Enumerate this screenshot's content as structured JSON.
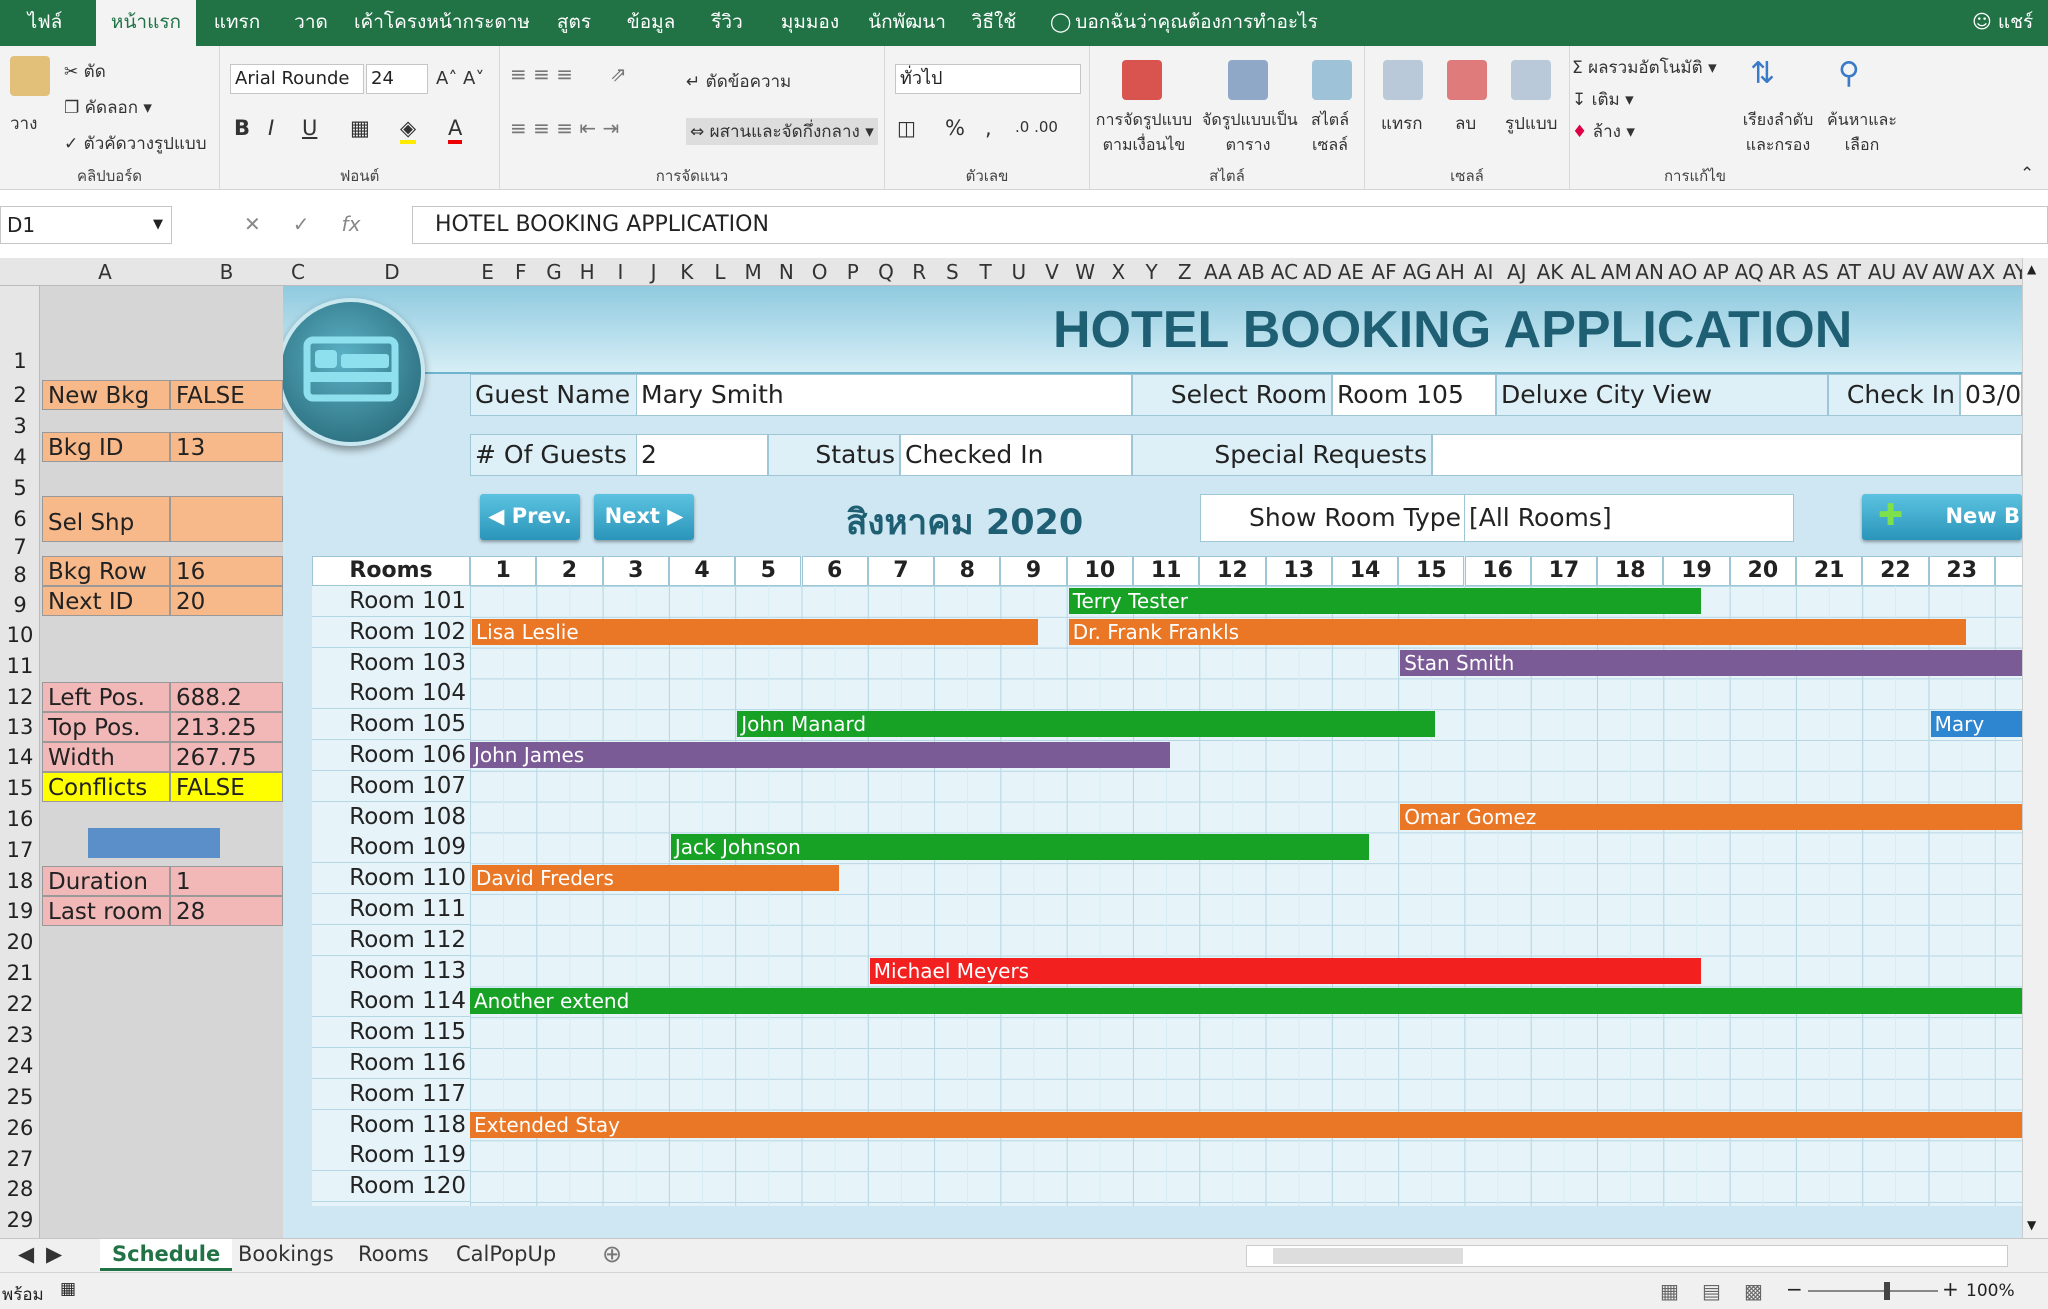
{
  "tabs": [
    "ไฟล์",
    "หน้าแรก",
    "แทรก",
    "วาด",
    "เค้าโครงหน้ากระดาษ",
    "สูตร",
    "ข้อมูล",
    "รีวิว",
    "มุมมอง",
    "นักพัฒนา",
    "วิธีใช้"
  ],
  "tell_me": "บอกฉันว่าคุณต้องการทำอะไร",
  "share": "แชร์",
  "ribbon": {
    "cut": "ตัด",
    "copy": "คัดลอก",
    "paste": "วาง",
    "format_painter": "ตัวคัดวางรูปแบบ",
    "clipboard": "คลิปบอร์ด",
    "font_name": "Arial Rounde",
    "font_size": "24",
    "bold": "B",
    "italic": "I",
    "underline": "U",
    "font_group": "ฟอนต์",
    "wrap_text": "ตัดข้อความ",
    "merge_center": "ผสานและจัดกึ่งกลาง",
    "alignment_group": "การจัดแนว",
    "number_format": "ทั่วไป",
    "percent": "%",
    "comma": ",",
    "number_group": "ตัวเลข",
    "cond_format_1": "การจัดรูปแบบ",
    "cond_format_2": "ตามเงื่อนไข",
    "format_table_1": "จัดรูปแบบเป็น",
    "format_table_2": "ตาราง",
    "cell_styles_1": "สไตล์",
    "cell_styles_2": "เซลล์",
    "styles_group": "สไตล์",
    "insert": "แทรก",
    "delete": "ลบ",
    "format": "รูปแบบ",
    "cells_group": "เซลล์",
    "autosum": "ผลรวมอัตโนมัติ",
    "fill": "เติม",
    "clear": "ล้าง",
    "sort_1": "เรียงลำดับ",
    "sort_2": "และกรอง",
    "find_1": "ค้นหาและ",
    "find_2": "เลือก",
    "editing_group": "การแก้ไข"
  },
  "namebox": "D1",
  "fx": "fx",
  "formula": "HOTEL BOOKING APPLICATION",
  "columns": [
    "A",
    "B",
    "C",
    "D",
    "E",
    "F",
    "G",
    "H",
    "I",
    "J",
    "K",
    "L",
    "M",
    "N",
    "O",
    "P",
    "Q",
    "R",
    "S",
    "T",
    "U",
    "V",
    "W",
    "X",
    "Y",
    "Z",
    "AA",
    "AB",
    "AC",
    "AD",
    "AE",
    "AF",
    "AG",
    "AH",
    "AI",
    "AJ",
    "AK",
    "AL",
    "AM",
    "AN",
    "AO",
    "AP",
    "AQ",
    "AR",
    "AS",
    "AT",
    "AU",
    "AV",
    "AW",
    "AX",
    "AY"
  ],
  "rows": [
    "1",
    "2",
    "3",
    "4",
    "5",
    "6",
    "7",
    "8",
    "9",
    "10",
    "11",
    "12",
    "13",
    "14",
    "15",
    "16",
    "17",
    "18",
    "19",
    "20",
    "21",
    "22",
    "23",
    "24",
    "25",
    "26",
    "27",
    "28",
    "29"
  ],
  "side_cells": [
    {
      "label": "New Bkg",
      "value": "FALSE"
    },
    {
      "label": "Bkg ID",
      "value": "13"
    },
    {
      "label": "Sel Shp",
      "value": ""
    },
    {
      "label": "Bkg Row",
      "value": "16"
    },
    {
      "label": "Next ID",
      "value": "20"
    },
    {
      "label": "Left Pos.",
      "value": "688.2"
    },
    {
      "label": "Top Pos.",
      "value": "213.25"
    },
    {
      "label": "Width",
      "value": "267.75"
    },
    {
      "label": "Conflicts",
      "value": "FALSE"
    },
    {
      "label": "Duration",
      "value": "1"
    },
    {
      "label": "Last room",
      "value": "28"
    }
  ],
  "app": {
    "title": "HOTEL BOOKING APPLICATION",
    "guest_name_label": "Guest Name",
    "guest_name": "Mary Smith",
    "select_room_label": "Select Room",
    "select_room": "Room 105",
    "room_desc": "Deluxe City View",
    "check_in_label": "Check In",
    "check_in": "03/0",
    "guests_label": "# Of Guests",
    "guests": "2",
    "status_label": "Status",
    "status": "Checked In",
    "special_label": "Special Requests",
    "special": "",
    "prev": "Prev.",
    "next": "Next",
    "month": "สิงหาคม 2020",
    "room_type_label": "Show Room Type",
    "room_type": "[All Rooms]",
    "new_button": "New B"
  },
  "calendar": {
    "rooms_header": "Rooms",
    "days": [
      "1",
      "2",
      "3",
      "4",
      "5",
      "6",
      "7",
      "8",
      "9",
      "10",
      "11",
      "12",
      "13",
      "14",
      "15",
      "16",
      "17",
      "18",
      "19",
      "20",
      "21",
      "22",
      "23",
      "2"
    ],
    "rooms": [
      "Room 101",
      "Room 102",
      "Room 103",
      "Room 104",
      "Room 105",
      "Room 106",
      "Room 107",
      "Room 108",
      "Room 109",
      "Room 110",
      "Room 111",
      "Room 112",
      "Room 113",
      "Room 114",
      "Room 115",
      "Room 116",
      "Room 117",
      "Room 118",
      "Room 119",
      "Room 120"
    ],
    "bookings": [
      {
        "guest": "Terry Tester",
        "room": 0,
        "start": 10,
        "end": 19,
        "color": "#17a226"
      },
      {
        "guest": "Lisa Leslie",
        "room": 1,
        "start": 1,
        "end": 9,
        "color": "#e97726"
      },
      {
        "guest": "Dr. Frank Frankls",
        "room": 1,
        "start": 10,
        "end": 23,
        "color": "#e97726"
      },
      {
        "guest": "Stan Smith",
        "room": 2,
        "start": 15,
        "end": 25,
        "color": "#7a5b96"
      },
      {
        "guest": "John Manard",
        "room": 4,
        "start": 5,
        "end": 15,
        "color": "#17a226"
      },
      {
        "guest": "Mary",
        "room": 4,
        "start": 23,
        "end": 25,
        "color": "#2e86d0"
      },
      {
        "guest": "John James",
        "room": 5,
        "start": 0,
        "end": 11,
        "color": "#7a5b96"
      },
      {
        "guest": "Omar Gomez",
        "room": 7,
        "start": 15,
        "end": 25,
        "color": "#e97726"
      },
      {
        "guest": "Jack Johnson",
        "room": 8,
        "start": 4,
        "end": 14,
        "color": "#17a226"
      },
      {
        "guest": "David Freders",
        "room": 9,
        "start": 1,
        "end": 6,
        "color": "#e97726"
      },
      {
        "guest": "Michael Meyers",
        "room": 12,
        "start": 7,
        "end": 19,
        "color": "#f32020"
      },
      {
        "guest": "Another extend",
        "room": 13,
        "start": 0,
        "end": 25,
        "color": "#17a226"
      },
      {
        "guest": "Extended Stay",
        "room": 17,
        "start": 0,
        "end": 25,
        "color": "#e97726"
      }
    ]
  },
  "sheets": [
    "Schedule",
    "Bookings",
    "Rooms",
    "CalPopUp"
  ],
  "status": {
    "ready": "พร้อม",
    "zoom": "100%"
  }
}
